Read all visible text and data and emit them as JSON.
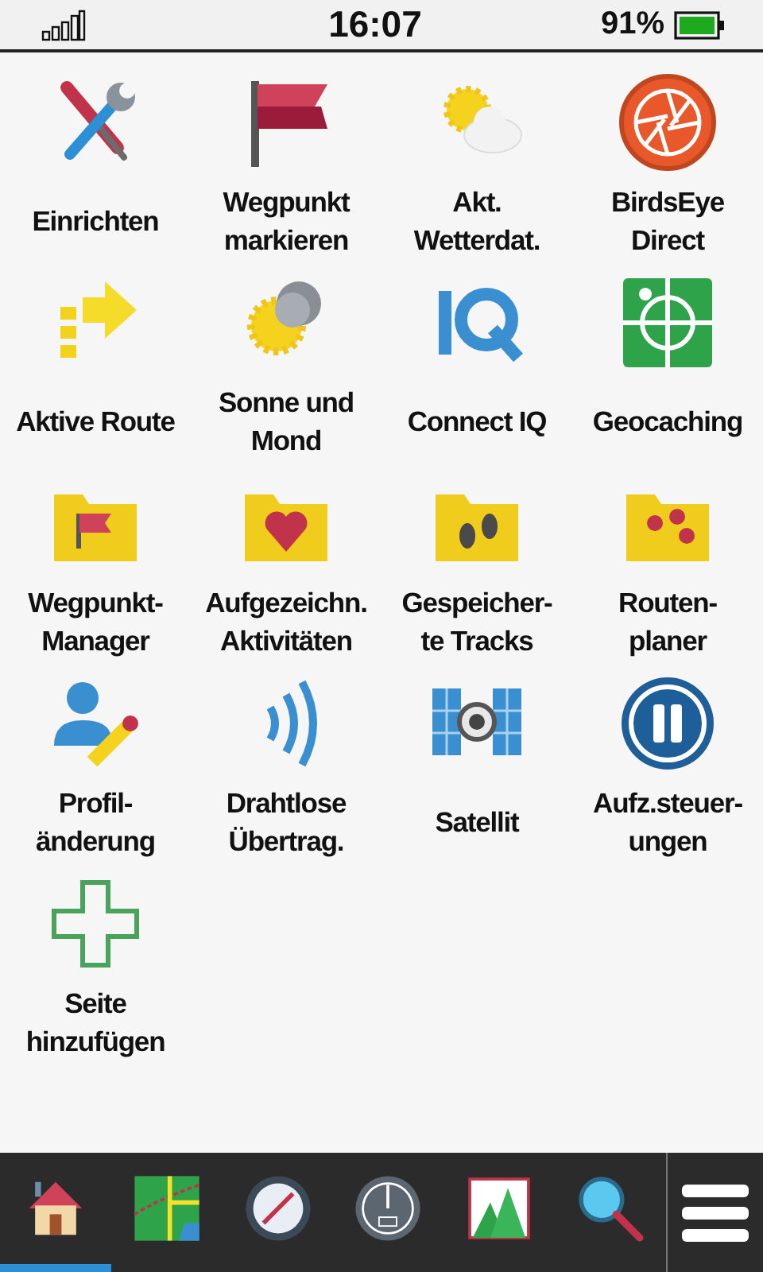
{
  "status_bar": {
    "time": "16:07",
    "battery": "91%"
  },
  "apps": [
    {
      "label": "Einrichten"
    },
    {
      "label": "Wegpunkt\nmarkieren"
    },
    {
      "label": "Akt.\nWetterdat."
    },
    {
      "label": "BirdsEye\nDirect"
    },
    {
      "label": "Aktive Route"
    },
    {
      "label": "Sonne und\nMond"
    },
    {
      "label": "Connect IQ"
    },
    {
      "label": "Geocaching"
    },
    {
      "label": "Wegpunkt-\nManager"
    },
    {
      "label": "Aufgezeichn.\nAktivitäten"
    },
    {
      "label": "Gespeicher-\nte Tracks"
    },
    {
      "label": "Routen-\nplaner"
    },
    {
      "label": "Profil-\nänderung"
    },
    {
      "label": "Drahtlose\nÜbertrag."
    },
    {
      "label": "Satellit"
    },
    {
      "label": "Aufz.steuer-\nungen"
    },
    {
      "label": "Seite\nhinzufügen"
    }
  ],
  "bottom_tabs": [
    {
      "selected": true
    },
    {
      "selected": false
    },
    {
      "selected": false
    },
    {
      "selected": false
    },
    {
      "selected": false
    },
    {
      "selected": false
    }
  ]
}
